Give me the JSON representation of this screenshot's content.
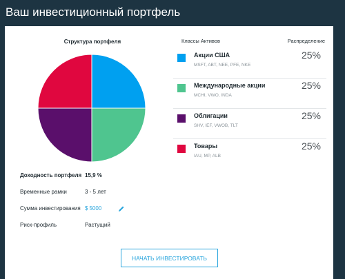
{
  "page": {
    "title": "Ваш инвестиционный портфель"
  },
  "chart": {
    "title": "Структура портфеля",
    "colors": [
      "#00a0f0",
      "#4fc58f",
      "#5a0f6b",
      "#e0073f"
    ]
  },
  "chart_data": {
    "type": "pie",
    "title": "Структура портфеля",
    "categories": [
      "Акции США",
      "Международные акции",
      "Облигации",
      "Товары"
    ],
    "values": [
      25,
      25,
      25,
      25
    ]
  },
  "stats": {
    "yield_label": "Доходность портфеля",
    "yield_value": "15,9 %",
    "horizon_label": "Временные рамки",
    "horizon_value": "3 - 5 лет",
    "amount_label": "Сумма инвестирования",
    "currency": "$",
    "amount_value": "5000",
    "risk_label": "Риск-профиль",
    "risk_value": "Растущий"
  },
  "table": {
    "classes_header": "Классы Активов",
    "distribution_header": "Распределение",
    "rows": [
      {
        "name": "Акции США",
        "tickers": "MSFT, ABT, NEE, PFE, NKE",
        "pct": "25%",
        "color": "#00a0f0"
      },
      {
        "name": "Международные акции",
        "tickers": "MCHI, VWO, INDA",
        "pct": "25%",
        "color": "#4fc58f"
      },
      {
        "name": "Облигации",
        "tickers": "SHV, IEF, VWOB, TLT",
        "pct": "25%",
        "color": "#5a0f6b"
      },
      {
        "name": "Товары",
        "tickers": "IAU, MP, ALB",
        "pct": "25%",
        "color": "#e0073f"
      }
    ]
  },
  "cta": {
    "label": "НАЧАТЬ ИНВЕСТИРОВАТЬ"
  }
}
